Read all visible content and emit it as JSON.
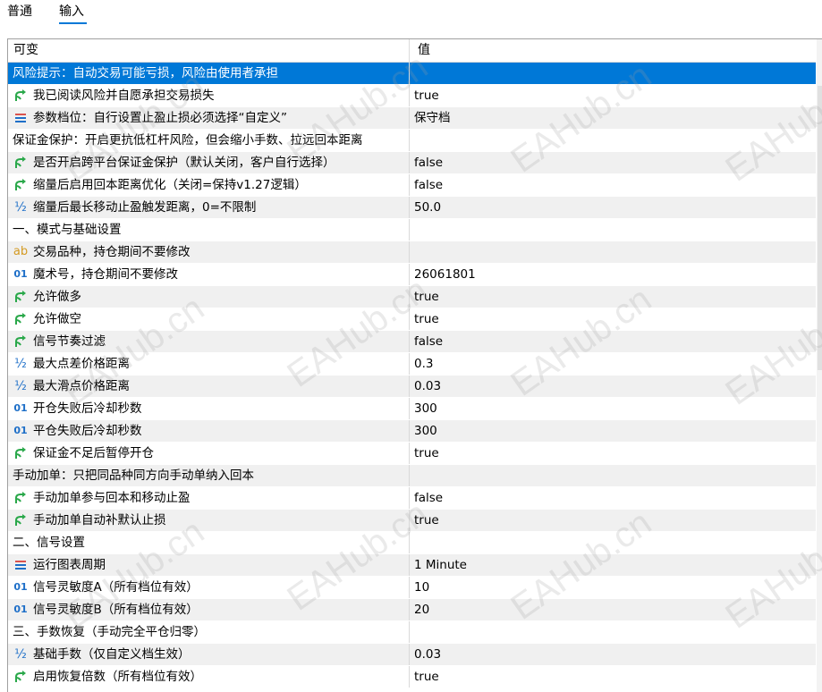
{
  "tabs": [
    {
      "label": "普通",
      "active": false
    },
    {
      "label": "输入",
      "active": true
    }
  ],
  "table": {
    "headers": {
      "variable": "可变",
      "value": "值"
    },
    "rows": [
      {
        "type": "section",
        "name": "风险提示：自动交易可能亏损，风险由使用者承担",
        "value": "",
        "selected": true
      },
      {
        "type": "param",
        "icon": "bool",
        "name": "我已阅读风险并自愿承担交易损失",
        "value": "true"
      },
      {
        "type": "param",
        "icon": "enum",
        "name": "参数档位：自行设置止盈止损必须选择“自定义”",
        "value": "保守档"
      },
      {
        "type": "section",
        "name": "保证金保护：开启更抗低杠杆风险，但会缩小手数、拉远回本距离",
        "value": ""
      },
      {
        "type": "param",
        "icon": "bool",
        "name": "是否开启跨平台保证金保护（默认关闭，客户自行选择）",
        "value": "false"
      },
      {
        "type": "param",
        "icon": "bool",
        "name": "缩量后启用回本距离优化（关闭=保持v1.27逻辑）",
        "value": "false"
      },
      {
        "type": "param",
        "icon": "double",
        "name": "缩量后最长移动止盈触发距离，0=不限制",
        "value": "50.0"
      },
      {
        "type": "section",
        "name": "一、模式与基础设置",
        "value": ""
      },
      {
        "type": "param",
        "icon": "string",
        "name": "交易品种，持仓期间不要修改",
        "value": ""
      },
      {
        "type": "param",
        "icon": "int",
        "name": "魔术号，持仓期间不要修改",
        "value": "26061801"
      },
      {
        "type": "param",
        "icon": "bool",
        "name": "允许做多",
        "value": "true"
      },
      {
        "type": "param",
        "icon": "bool",
        "name": "允许做空",
        "value": "true"
      },
      {
        "type": "param",
        "icon": "bool",
        "name": "信号节奏过滤",
        "value": "false"
      },
      {
        "type": "param",
        "icon": "double",
        "name": "最大点差价格距离",
        "value": "0.3"
      },
      {
        "type": "param",
        "icon": "double",
        "name": "最大滑点价格距离",
        "value": "0.03"
      },
      {
        "type": "param",
        "icon": "int",
        "name": "开仓失败后冷却秒数",
        "value": "300"
      },
      {
        "type": "param",
        "icon": "int",
        "name": "平仓失败后冷却秒数",
        "value": "300"
      },
      {
        "type": "param",
        "icon": "bool",
        "name": "保证金不足后暂停开仓",
        "value": "true"
      },
      {
        "type": "section",
        "name": "手动加单：只把同品种同方向手动单纳入回本",
        "value": ""
      },
      {
        "type": "param",
        "icon": "bool",
        "name": "手动加单参与回本和移动止盈",
        "value": "false"
      },
      {
        "type": "param",
        "icon": "bool",
        "name": "手动加单自动补默认止损",
        "value": "true"
      },
      {
        "type": "section",
        "name": "二、信号设置",
        "value": ""
      },
      {
        "type": "param",
        "icon": "enum",
        "name": "运行图表周期",
        "value": "1 Minute"
      },
      {
        "type": "param",
        "icon": "int",
        "name": "信号灵敏度A（所有档位有效）",
        "value": "10"
      },
      {
        "type": "param",
        "icon": "int",
        "name": "信号灵敏度B（所有档位有效）",
        "value": "20"
      },
      {
        "type": "section",
        "name": "三、手数恢复（手动完全平仓归零）",
        "value": ""
      },
      {
        "type": "param",
        "icon": "double",
        "name": "基础手数（仅自定义档生效）",
        "value": "0.03"
      },
      {
        "type": "param",
        "icon": "bool",
        "name": "启用恢复倍数（所有档位有效）",
        "value": "true"
      }
    ]
  },
  "icons": {
    "bool": "branch-arrow-icon",
    "enum": "list-icon",
    "double": "half-fraction-icon",
    "int": "digits-01-icon",
    "string": "ab-text-icon"
  },
  "icon_glyphs": {
    "int": "01",
    "string": "ab",
    "double": "½"
  },
  "watermark": "EAHub.cn",
  "colors": {
    "selected": "#0078d7",
    "bool_icon": "#2aa84a",
    "enum_icon": "#d9534f",
    "int_icon": "#1e6fc8",
    "string_icon": "#d49a22"
  }
}
